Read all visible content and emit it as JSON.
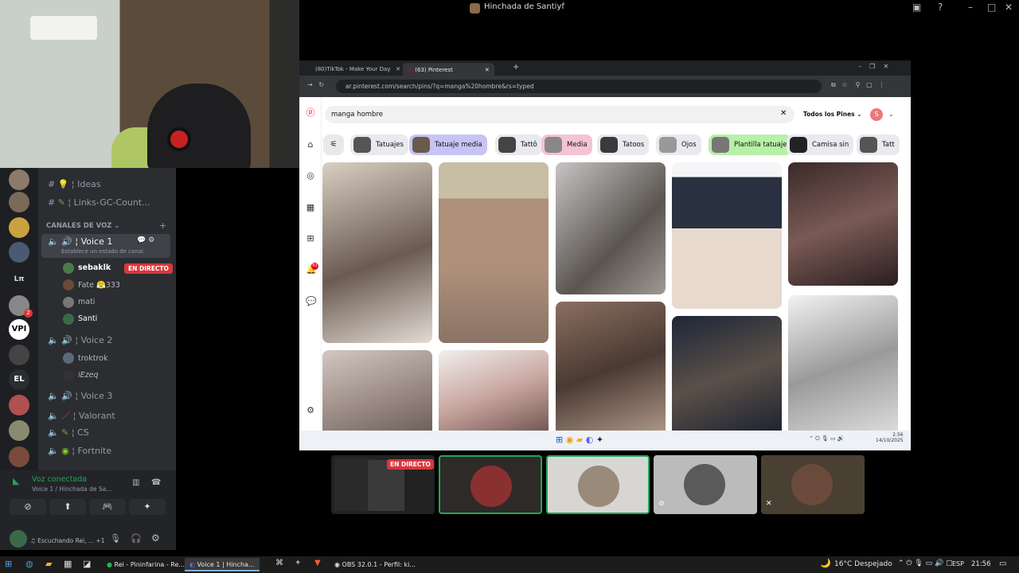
{
  "window": {
    "title": "Hinchada de Santiyf"
  },
  "discord": {
    "channels_top": [
      {
        "name": "Ideas",
        "icon": "bulb-icon"
      },
      {
        "name": "Links-GC-Count...",
        "icon": "link-icon"
      }
    ],
    "voice_section_label": "CANALES DE VOZ",
    "voice_channels": [
      {
        "name": "Voice 1",
        "status_hint": "Establece un estado de canal",
        "members": [
          {
            "name": "sebaklk",
            "badge": "EN DIRECTO"
          },
          {
            "name": "Fate",
            "extra": "333"
          },
          {
            "name": "mati"
          },
          {
            "name": "Santi"
          }
        ]
      },
      {
        "name": "Voice 2",
        "members": [
          {
            "name": "troktrok"
          },
          {
            "name": "iEzeq"
          }
        ]
      },
      {
        "name": "Voice 3",
        "members": []
      },
      {
        "name": "Valorant",
        "members": []
      },
      {
        "name": "CS",
        "members": []
      },
      {
        "name": "Fortnite",
        "members": []
      }
    ],
    "servers": [
      "Lπ",
      "VPI",
      "EL"
    ],
    "server_badge": "2",
    "voice_panel": {
      "status": "Voz conectada",
      "location": "Voice 1 / Hinchada de Sa...",
      "user_status": "Escuchando Rei, ... +1"
    }
  },
  "browser": {
    "tabs": [
      {
        "label": "(80)TikTok - Make Your Day"
      },
      {
        "label": "(63) Pinterest",
        "selected": true
      }
    ],
    "url": "ar.pinterest.com/search/pins/?q=manga%20hombre&rs=typed",
    "search_value": "manga hombre",
    "filter_label": "Todos los Pines",
    "profile_initial": "S",
    "notification_count": "63",
    "chips": [
      "Tatuajes",
      "Tatuaje media",
      "Tattô",
      "Media",
      "Tatoos",
      "Ojos",
      "Plantilla tatuaje",
      "Camisa sin",
      "Tatt"
    ],
    "inner_clock": {
      "time": "2:56",
      "date": "14/10/2025"
    }
  },
  "video_tiles": [
    {
      "label": "EN DIRECTO"
    },
    {},
    {},
    {},
    {}
  ],
  "taskbar": {
    "apps": [
      {
        "label": "Rei - Pininfarina - Re..."
      },
      {
        "label": "Voice 1 | Hincha...",
        "selected": true
      },
      {
        "label": "OBS 32.0.1 - Perfil: ki..."
      }
    ],
    "weather": "16°C Despejado",
    "lang": "ESP",
    "time": "21:56"
  },
  "colors": {
    "live_red": "#da373c",
    "discord_bg": "#2b2d31",
    "chip_purple": "#c7c3f5",
    "chip_green": "#b8f0a8"
  }
}
